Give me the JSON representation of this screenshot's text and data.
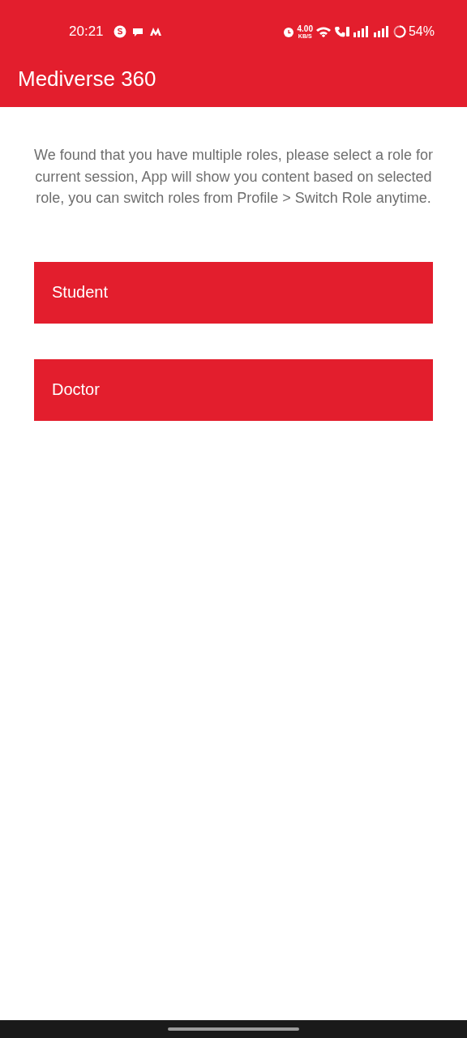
{
  "status_bar": {
    "time": "20:21",
    "speed_value": "4.00",
    "speed_unit": "KB/S",
    "battery": "54%"
  },
  "app_bar": {
    "title": "Mediverse 360"
  },
  "message": "We found that you have multiple roles, please select a role for current session, App will show you content based on selected role, you can switch roles from Profile > Switch Role anytime.",
  "roles": [
    {
      "label": "Student"
    },
    {
      "label": "Doctor"
    }
  ]
}
